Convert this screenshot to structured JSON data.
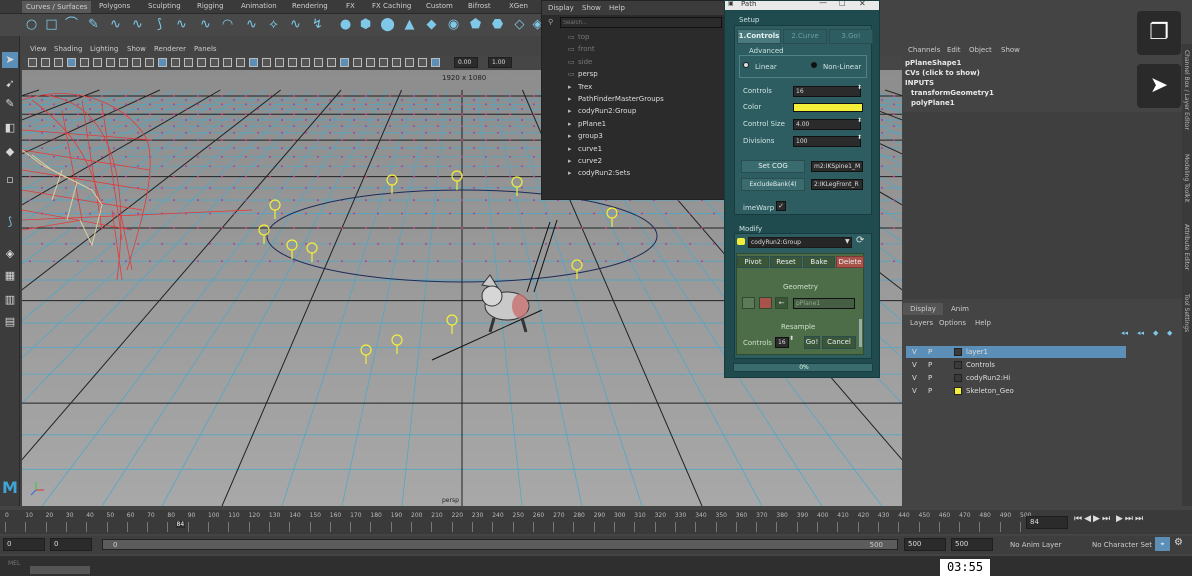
{
  "shelf_tabs": [
    "Curves / Surfaces",
    "Polygons",
    "Sculpting",
    "Rigging",
    "Animation",
    "Rendering",
    "FX",
    "FX Caching",
    "Custom",
    "Bifrost",
    "XGen"
  ],
  "viewport_menu": [
    "View",
    "Shading",
    "Lighting",
    "Show",
    "Renderer",
    "Panels"
  ],
  "viewport": {
    "resolution": "1920 x 1080",
    "camera": "persp",
    "field_a": "0.00",
    "field_b": "1.00"
  },
  "outliner": {
    "menu": [
      "Display",
      "Show",
      "Help"
    ],
    "search_placeholder": "Search...",
    "items": [
      "top",
      "front",
      "side",
      "persp",
      "Trex",
      "PathFinderMasterGroups",
      "codyRun2:Group",
      "pPlane1",
      "group3",
      "curve1",
      "curve2",
      "codyRun2:Sets"
    ]
  },
  "tool_window": {
    "title": "Path",
    "setup_label": "Setup",
    "tabs": [
      "1.Controls",
      "2.Curve",
      "3.Go!"
    ],
    "advanced_label": "Advanced",
    "mode_linear": "Linear",
    "mode_nonlinear": "Non-Linear",
    "controls_label": "Controls",
    "controls_value": "16",
    "color_label": "Color",
    "color_value": "#f2ee3a",
    "control_size_label": "Control Size",
    "control_size_value": "4.00",
    "divisions_label": "Divisions",
    "divisions_value": "100",
    "set_cog": "Set COG",
    "set_cog_value": "m2:IKSpine1_M",
    "exclude_bank": "ExcludeBank(4)",
    "exclude_bank_value": "2:IKLegFront_R",
    "timewarp_label": "imeWarp",
    "modify_label": "Modify",
    "group_value": "codyRun2:Group",
    "actions": [
      "Pivot",
      "Reset",
      "Bake",
      "Delete"
    ],
    "geometry_label": "Geometry",
    "geometry_value": "pPlane1",
    "resample_label": "Resample",
    "resample_controls_label": "Controls",
    "resample_controls_value": "16",
    "go_label": "Go!",
    "cancel_label": "Cancel",
    "progress_text": "0%"
  },
  "channel_box": {
    "menu": [
      "Channels",
      "Edit",
      "Object",
      "Show"
    ],
    "shape": "pPlaneShape1",
    "cvs": "CVs (click to show)",
    "inputs": "INPUTS",
    "input_items": [
      "transformGeometry1",
      "polyPlane1"
    ]
  },
  "layer_editor": {
    "tabs": [
      "Display",
      "Anim"
    ],
    "menu": [
      "Layers",
      "Options",
      "Help"
    ],
    "layers": [
      {
        "v": "V",
        "p": "P",
        "name": "layer1",
        "color": ""
      },
      {
        "v": "V",
        "p": "P",
        "name": "Controls",
        "color": ""
      },
      {
        "v": "V",
        "p": "P",
        "name": "codyRun2:Hi",
        "color": ""
      },
      {
        "v": "V",
        "p": "P",
        "name": "Skeleton_Geo",
        "color": "#f2ee3a"
      }
    ]
  },
  "right_tabs": [
    "Channel Box / Layer Editor",
    "Modeling Toolkit",
    "Attribute Editor",
    "Tool Settings"
  ],
  "timeline": {
    "ticks": [
      "0",
      "10",
      "20",
      "30",
      "40",
      "50",
      "60",
      "70",
      "80",
      "90",
      "100",
      "110",
      "120",
      "130",
      "140",
      "150",
      "160",
      "170",
      "180",
      "190",
      "200",
      "210",
      "220",
      "230",
      "240",
      "250",
      "260",
      "270",
      "280",
      "290",
      "300",
      "310",
      "320",
      "330",
      "340",
      "350",
      "360",
      "370",
      "380",
      "390",
      "400",
      "410",
      "420",
      "430",
      "440",
      "450",
      "460",
      "470",
      "480",
      "490",
      "500"
    ],
    "current_frame": "84",
    "frame_field": "84"
  },
  "range": {
    "start_a": "0",
    "start_b": "0",
    "slider_start": "0",
    "slider_end": "500",
    "end_a": "500",
    "end_b": "500",
    "anim_layer": "No Anim Layer",
    "character_set": "No Character Set"
  },
  "command_line": {
    "label": "MEL"
  },
  "video_time": "03:55"
}
